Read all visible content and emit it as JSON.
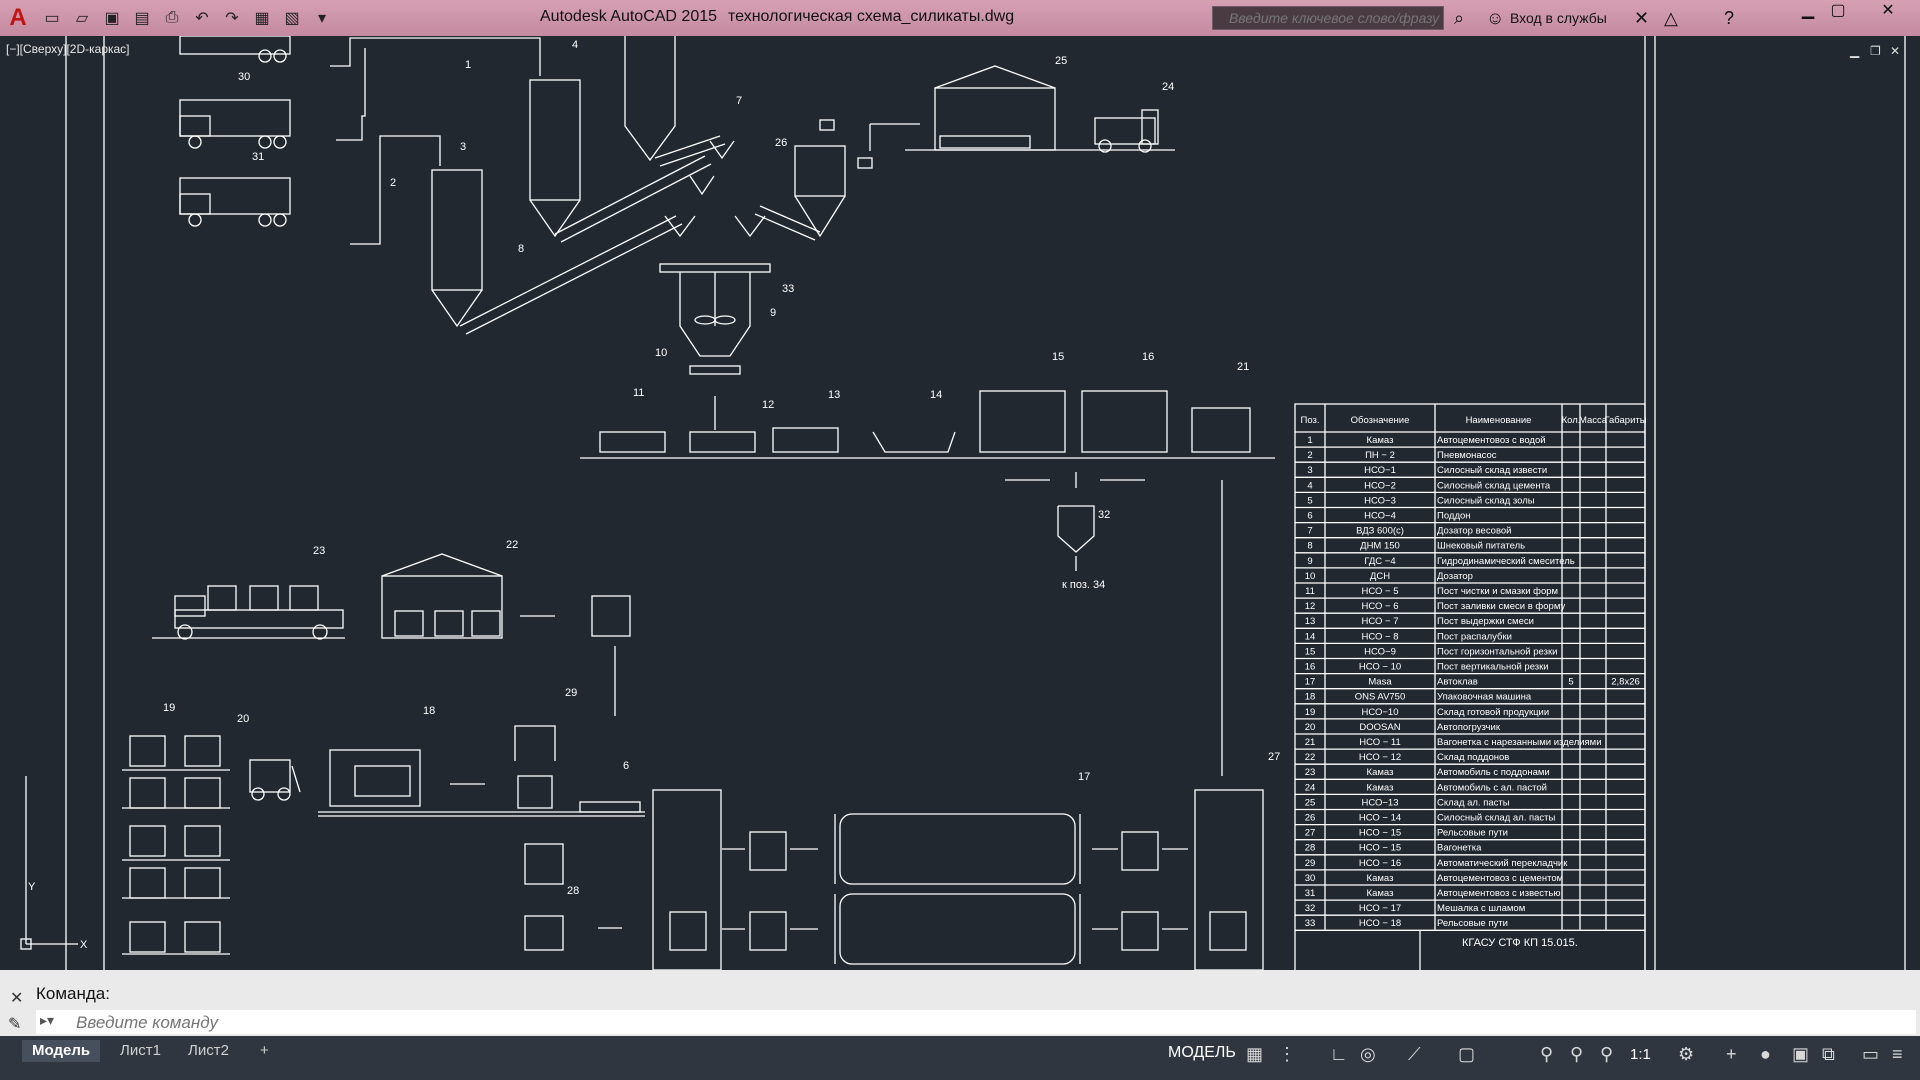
{
  "window": {
    "app_title": "Autodesk AutoCAD 2015",
    "file_title": "технологическая схема_силикаты.dwg",
    "search_placeholder": "Введите ключевое слово/фразу",
    "login_label": "Вход в службы",
    "icons": [
      "new-icon",
      "open-icon",
      "save-icon",
      "saveas-icon",
      "print-icon",
      "undo-icon",
      "redo-icon",
      "plot-icon",
      "share-icon",
      "dropdown-icon"
    ],
    "accent": "#c48aa0"
  },
  "viewport": {
    "label": "[−][Сверху][2D-каркас]"
  },
  "drawing": {
    "equipment_labels": [
      "1",
      "2",
      "3",
      "4",
      "6",
      "7",
      "8",
      "9",
      "10",
      "11",
      "12",
      "13",
      "14",
      "15",
      "16",
      "17",
      "18",
      "19",
      "20",
      "21",
      "22",
      "23",
      "24",
      "25",
      "26",
      "27",
      "28",
      "29",
      "30",
      "31",
      "32",
      "33"
    ],
    "note_to_34": "к поз. 34",
    "ucs_y": "Y",
    "ucs_x": "X"
  },
  "spec_table": {
    "headers": [
      "Поз.",
      "Обозначение",
      "Наименование",
      "Кол.",
      "Масса",
      "Габариты"
    ],
    "rows": [
      [
        "1",
        "Камаз",
        "Автоцементовоз с водой",
        "",
        "",
        ""
      ],
      [
        "2",
        "ПН − 2",
        "Пневмонасос",
        "",
        "",
        ""
      ],
      [
        "3",
        "НСО−1",
        "Силосный склад извести",
        "",
        "",
        ""
      ],
      [
        "4",
        "НСО−2",
        "Силосный склад цемента",
        "",
        "",
        ""
      ],
      [
        "5",
        "НСО−3",
        "Силосный склад золы",
        "",
        "",
        ""
      ],
      [
        "6",
        "НСО−4",
        "Поддон",
        "",
        "",
        ""
      ],
      [
        "7",
        "ВДЗ 600(с)",
        "Дозатор весовой",
        "",
        "",
        ""
      ],
      [
        "8",
        "ДНМ 150",
        "Шнековый питатель",
        "",
        "",
        ""
      ],
      [
        "9",
        "ГДС −4",
        "Гидродинамический смеситель",
        "",
        "",
        ""
      ],
      [
        "10",
        "ДСН",
        "Дозатор",
        "",
        "",
        ""
      ],
      [
        "11",
        "НСО − 5",
        "Пост чистки и смазки форм",
        "",
        "",
        ""
      ],
      [
        "12",
        "НСО − 6",
        "Пост заливки смеси в форму",
        "",
        "",
        ""
      ],
      [
        "13",
        "НСО − 7",
        "Пост выдержки смеси",
        "",
        "",
        ""
      ],
      [
        "14",
        "НСО − 8",
        "Пост распалубки",
        "",
        "",
        ""
      ],
      [
        "15",
        "НСО−9",
        "Пост горизонтальной резки",
        "",
        "",
        ""
      ],
      [
        "16",
        "НСО − 10",
        "Пост вертикальной резки",
        "",
        "",
        ""
      ],
      [
        "17",
        "Masa",
        "Автоклав",
        "5",
        "",
        "2,8x26"
      ],
      [
        "18",
        "ONS AV750",
        "Упаковочная машина",
        "",
        "",
        ""
      ],
      [
        "19",
        "НСО−10",
        "Склад готовой продукции",
        "",
        "",
        ""
      ],
      [
        "20",
        "DOOSAN",
        "Автопогрузчик",
        "",
        "",
        ""
      ],
      [
        "21",
        "НСО − 11",
        "Вагонетка с нарезанными изделиями",
        "",
        "",
        ""
      ],
      [
        "22",
        "НСО − 12",
        "Склад поддонов",
        "",
        "",
        ""
      ],
      [
        "23",
        "Камаз",
        "Автомобиль с поддонами",
        "",
        "",
        ""
      ],
      [
        "24",
        "Камаз",
        "Автомобиль с ал. пастой",
        "",
        "",
        ""
      ],
      [
        "25",
        "НСО−13",
        "Склад ал. пасты",
        "",
        "",
        ""
      ],
      [
        "26",
        "НСО − 14",
        "Силосный склад ал. пасты",
        "",
        "",
        ""
      ],
      [
        "27",
        "НСО − 15",
        "Рельсовые пути",
        "",
        "",
        ""
      ],
      [
        "28",
        "НСО − 15",
        "Вагонетка",
        "",
        "",
        ""
      ],
      [
        "29",
        "НСО − 16",
        "Автоматический перекладчик",
        "",
        "",
        ""
      ],
      [
        "30",
        "Камаз",
        "Автоцементовоз с цементом",
        "",
        "",
        ""
      ],
      [
        "31",
        "Камаз",
        "Автоцементовоз с известью",
        "",
        "",
        ""
      ],
      [
        "32",
        "НСО − 17",
        "Мешалка с шламом",
        "",
        "",
        ""
      ],
      [
        "33",
        "НСО − 18",
        "Рельсовые пути",
        "",
        "",
        ""
      ]
    ],
    "stamp_title": "КГАСУ СТФ КП 15.015."
  },
  "command": {
    "history_label": "Команда:",
    "placeholder": "Введите команду"
  },
  "status": {
    "layout_tabs": [
      "Модель",
      "Лист1",
      "Лист2"
    ],
    "add_tab": "+",
    "model_label": "МОДЕЛЬ",
    "scale_label": "1:1"
  }
}
